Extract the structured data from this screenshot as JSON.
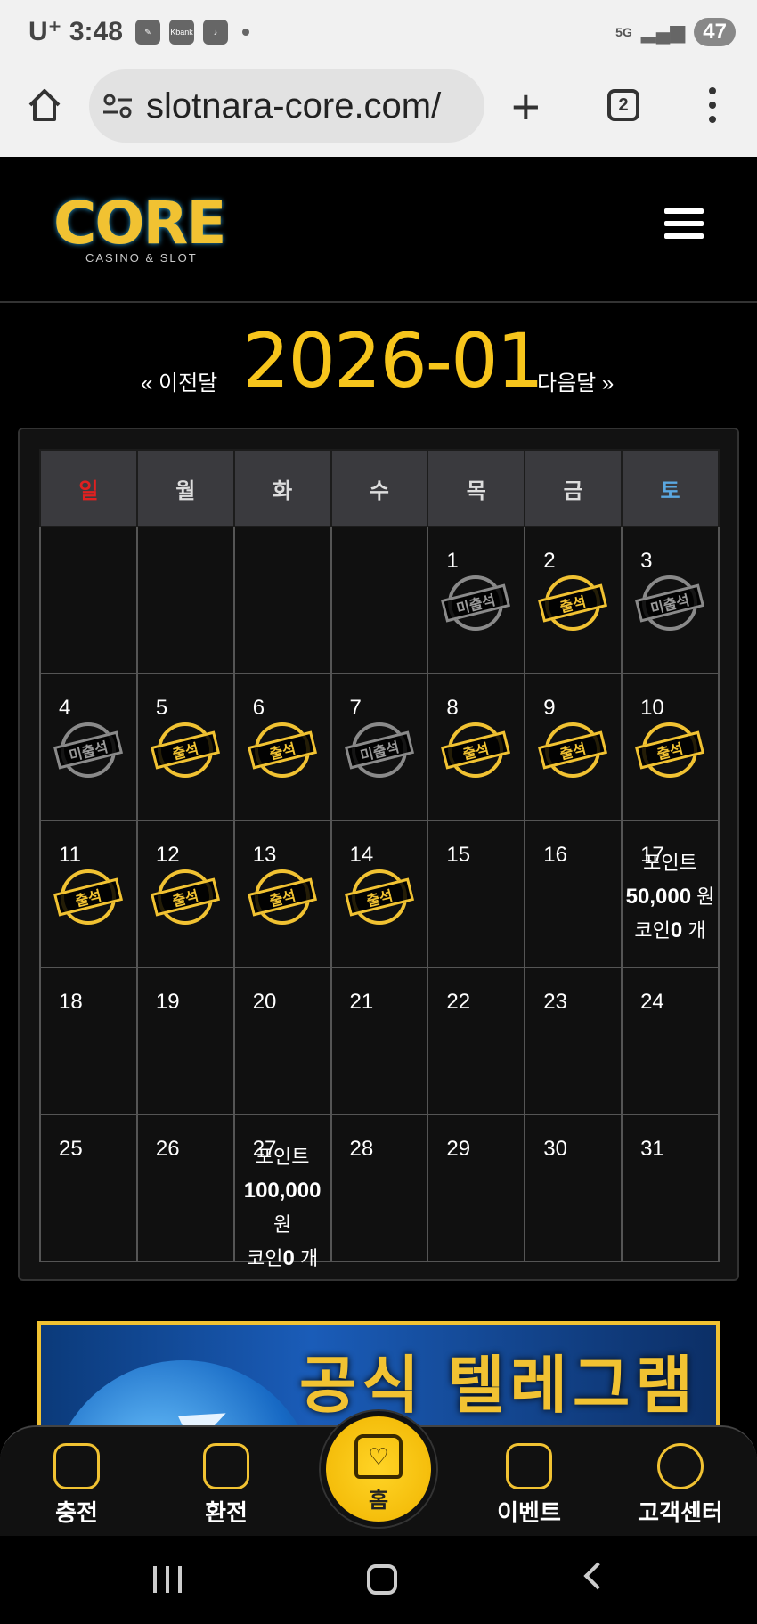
{
  "status": {
    "carrier": "U⁺",
    "time": "3:48",
    "notif_icons": [
      "bee-icon",
      "kbank-icon",
      "tiktok-icon"
    ],
    "kbank": "Kbank",
    "network": "5G",
    "battery": "47"
  },
  "browser": {
    "url": "slotnara-core.com/",
    "tab_count": "2"
  },
  "site": {
    "logo_main": "CORE",
    "logo_sub": "CASINO & SLOT"
  },
  "calendar": {
    "prev_label": "« 이전달",
    "title": "2026-01",
    "next_label": "다음달 »",
    "weekdays": [
      "일",
      "월",
      "화",
      "수",
      "목",
      "금",
      "토"
    ],
    "stamp_present": "출석",
    "stamp_absent": "미출석",
    "weeks": [
      [
        {
          "day": ""
        },
        {
          "day": ""
        },
        {
          "day": ""
        },
        {
          "day": ""
        },
        {
          "day": "1",
          "stamp": "absent"
        },
        {
          "day": "2",
          "stamp": "present"
        },
        {
          "day": "3",
          "stamp": "absent"
        }
      ],
      [
        {
          "day": "4",
          "stamp": "absent"
        },
        {
          "day": "5",
          "stamp": "present"
        },
        {
          "day": "6",
          "stamp": "present"
        },
        {
          "day": "7",
          "stamp": "absent"
        },
        {
          "day": "8",
          "stamp": "present"
        },
        {
          "day": "9",
          "stamp": "present"
        },
        {
          "day": "10",
          "stamp": "present"
        }
      ],
      [
        {
          "day": "11",
          "stamp": "present"
        },
        {
          "day": "12",
          "stamp": "present"
        },
        {
          "day": "13",
          "stamp": "present"
        },
        {
          "day": "14",
          "stamp": "present"
        },
        {
          "day": "15"
        },
        {
          "day": "16"
        },
        {
          "day": "17",
          "reward": {
            "point_label": "포인트",
            "amount": "50,000",
            "unit": "원",
            "coin_label": "코인",
            "coin": "0",
            "coin_unit": "개"
          }
        }
      ],
      [
        {
          "day": "18"
        },
        {
          "day": "19"
        },
        {
          "day": "20"
        },
        {
          "day": "21"
        },
        {
          "day": "22"
        },
        {
          "day": "23"
        },
        {
          "day": "24"
        }
      ],
      [
        {
          "day": "25"
        },
        {
          "day": "26"
        },
        {
          "day": "27",
          "reward": {
            "point_label": "포인트",
            "amount": "100,000",
            "unit": "원",
            "coin_label": "코인",
            "coin": "0",
            "coin_unit": "개"
          }
        },
        {
          "day": "28"
        },
        {
          "day": "29"
        },
        {
          "day": "30"
        },
        {
          "day": "31"
        }
      ]
    ]
  },
  "banner": {
    "text": "공식 텔레그램"
  },
  "bottom_nav": {
    "charge": "충전",
    "exchange": "환전",
    "home": "홈",
    "event": "이벤트",
    "support": "고객센터"
  }
}
